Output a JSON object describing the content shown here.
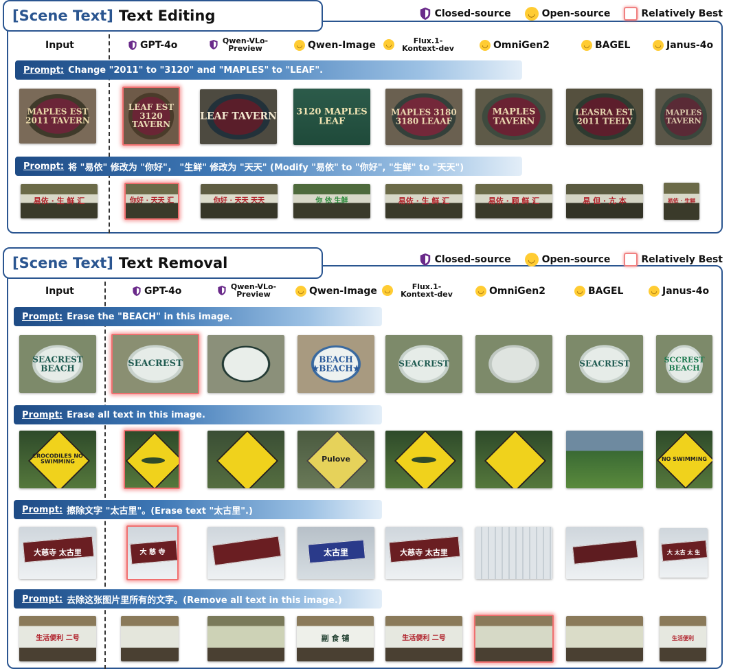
{
  "section1": {
    "tag": "[Scene Text]",
    "title": "Text Editing"
  },
  "section2": {
    "tag": "[Scene Text]",
    "title": "Text Removal"
  },
  "legend": {
    "closed": "Closed-source",
    "open": "Open-source",
    "best": "Relatively Best"
  },
  "columns": {
    "input": "Input",
    "gpt4o": "GPT-4o",
    "qwenvlo": "Qwen-VLo-Preview",
    "qwenimage": "Qwen-Image",
    "flux": "Flux.1-Kontext-dev",
    "omnigen2": "OmniGen2",
    "bagel": "BAGEL",
    "janus": "Janus-4o"
  },
  "prompt_key": "Prompt:",
  "prompts": {
    "p1": "Change \"2011\" to \"3120\" and \"MAPLES\" to \"LEAF\".",
    "p2": "将 \"易依\" 修改为 \"你好\"， \"生鲜\" 修改为 \"天天\" (Modify \"易依\" to \"你好\", \"生鲜\" to \"天天\")",
    "p3": "Erase the \"BEACH\" in this image.",
    "p4": "Erase all text in this image.",
    "p5": "擦除文字 \"太古里\"。(Erase text \"太古里\".)",
    "p6": "去除这张图片里所有的文字。(Remove all text in this image.)"
  },
  "thumb_text": {
    "maples_in": "MAPLES EST 2011 TAVERN",
    "leaf_gpt": "LEAF EST 3120 TAVERN",
    "leaf_qwenvlo": "LEAF TAVERN",
    "leaf_qwenimage": "3120 MAPLES LEAF",
    "leaf_flux": "MAPLES 3180 3180 LEAAF",
    "leaf_omni": "MAPLES TAVERN",
    "leaf_bagel": "LEASRA EST 2011 TEELY",
    "leaf_janus": "MAPLES TAVERN",
    "cn_in": "易依 · 生 鲜 汇",
    "cn_gpt": "你好 · 天天 汇",
    "cn_qwenvlo": "你好 · 天天 天天",
    "cn_qwenimage": "你 依 生鲜",
    "cn_flux": "易依 · 生 鲜 汇",
    "cn_omni": "易依 · 顾 鲜 汇",
    "cn_bagel": "易 但 · 亢 本",
    "cn_janus": "易依 · 生鲜",
    "beach_in": "SEACREST BEACH",
    "beach_gpt": "SEACREST",
    "beach_qwenvlo": "",
    "beach_qwenimage": "BEACH ★BEACH★",
    "beach_flux": "SEACREST",
    "beach_omni": "",
    "beach_bagel": "SEACREST",
    "beach_janus": "SCCREST BEACH",
    "croc_in": "CROCODILES NO SWIMMING",
    "croc_qwenimage": "Pulove",
    "croc_janus": "NO SWIMMING",
    "tg_in": "大慈寺 太古里",
    "tg_gpt": "大 慈 寺",
    "tg_qwenvlo": "",
    "tg_qwenimage": "太古里",
    "tg_flux": "大慈寺 太古里",
    "tg_bagel": "",
    "tg_janus": "大 太古 太 生",
    "shop_in": "生活便利 二号",
    "shop_qwenimage": "副 食 铺",
    "shop_flux": "生活便利 二号",
    "shop_janus": "生活便利"
  },
  "colors": {
    "accent": "#2a5590",
    "best": "#f07070",
    "open": "#ffcc33",
    "closed": "#6a2a8a"
  }
}
